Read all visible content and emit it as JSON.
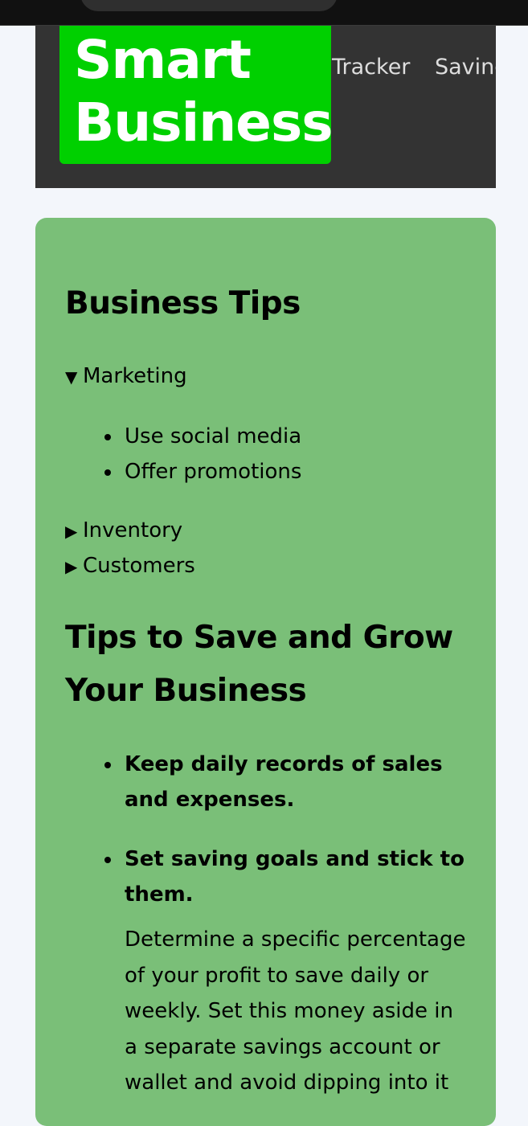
{
  "header": {
    "logo_line1": "Smart",
    "logo_line2": "Business",
    "nav": [
      "Tracker",
      "Savings"
    ]
  },
  "business_tips": {
    "title": "Business Tips",
    "sections": [
      {
        "label": "Marketing",
        "open": true,
        "items": [
          "Use social media",
          "Offer promotions"
        ]
      },
      {
        "label": "Inventory",
        "open": false
      },
      {
        "label": "Customers",
        "open": false
      }
    ]
  },
  "save_grow": {
    "title": "Tips to Save and Grow Your Business",
    "tips": [
      {
        "heading": "Keep daily records of sales and expenses."
      },
      {
        "heading": "Set saving goals and stick to them.",
        "body": "Determine a specific percentage of your profit to save daily or weekly. Set this money aside in a separate savings account or wallet and avoid dipping into it"
      }
    ]
  },
  "colors": {
    "logo_bg": "#00d000",
    "header_bg": "#333333",
    "card_bg": "#7abf78",
    "page_bg": "#f3f6fb"
  },
  "icons": {
    "open_marker": "triangle-down-icon",
    "closed_marker": "triangle-right-icon"
  }
}
